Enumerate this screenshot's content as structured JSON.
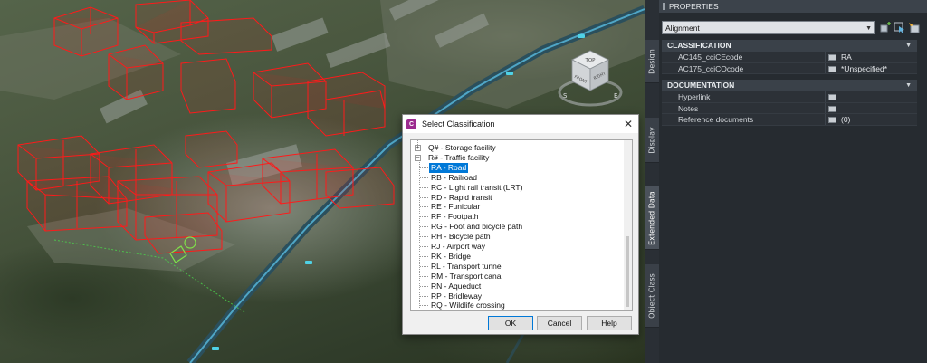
{
  "viewcube": {
    "top": "TOP",
    "front": "FRONT",
    "right": "RIGHT",
    "compass_s": "S",
    "compass_e": "E"
  },
  "dialog": {
    "title": "Select Classification",
    "tree": [
      {
        "label": "Q# - Storage facility",
        "level": 0,
        "expander": "+"
      },
      {
        "label": "R# - Traffic facility",
        "level": 0,
        "expander": "−"
      },
      {
        "label": "RA - Road",
        "level": 1,
        "selected": true
      },
      {
        "label": "RB - Railroad",
        "level": 1
      },
      {
        "label": "RC - Light rail transit (LRT)",
        "level": 1
      },
      {
        "label": "RD - Rapid transit",
        "level": 1
      },
      {
        "label": "RE - Funicular",
        "level": 1
      },
      {
        "label": "RF - Footpath",
        "level": 1
      },
      {
        "label": "RG - Foot and bicycle path",
        "level": 1
      },
      {
        "label": "RH - Bicycle path",
        "level": 1
      },
      {
        "label": "RJ - Airport way",
        "level": 1
      },
      {
        "label": "RK - Bridge",
        "level": 1
      },
      {
        "label": "RL - Transport tunnel",
        "level": 1
      },
      {
        "label": "RM - Transport canal",
        "level": 1
      },
      {
        "label": "RN - Aqueduct",
        "level": 1
      },
      {
        "label": "RP - Bridleway",
        "level": 1
      },
      {
        "label": "RQ - Wildlife crossing",
        "level": 1
      }
    ],
    "buttons": {
      "ok": "OK",
      "cancel": "Cancel",
      "help": "Help"
    }
  },
  "tabs": [
    {
      "label": "Design",
      "active": false
    },
    {
      "label": "Display",
      "active": false
    },
    {
      "label": "Extended Data",
      "active": true
    },
    {
      "label": "Object Class",
      "active": false
    }
  ],
  "properties": {
    "title": "PROPERTIES",
    "object_type": "Alignment",
    "sections": [
      {
        "name": "CLASSIFICATION",
        "rows": [
          {
            "name": "AC145_cciCEcode",
            "value": "RA"
          },
          {
            "name": "AC175_cciCOcode",
            "value": "*Unspecified*"
          }
        ]
      },
      {
        "name": "DOCUMENTATION",
        "rows": [
          {
            "name": "Hyperlink",
            "value": ""
          },
          {
            "name": "Notes",
            "value": ""
          },
          {
            "name": "Reference documents",
            "value": "(0)"
          }
        ]
      }
    ]
  },
  "colors": {
    "selection": "#0078d7",
    "wireframe": "#ff1a1a",
    "road": "#5aa9c9",
    "panel_bg": "#262b30"
  }
}
